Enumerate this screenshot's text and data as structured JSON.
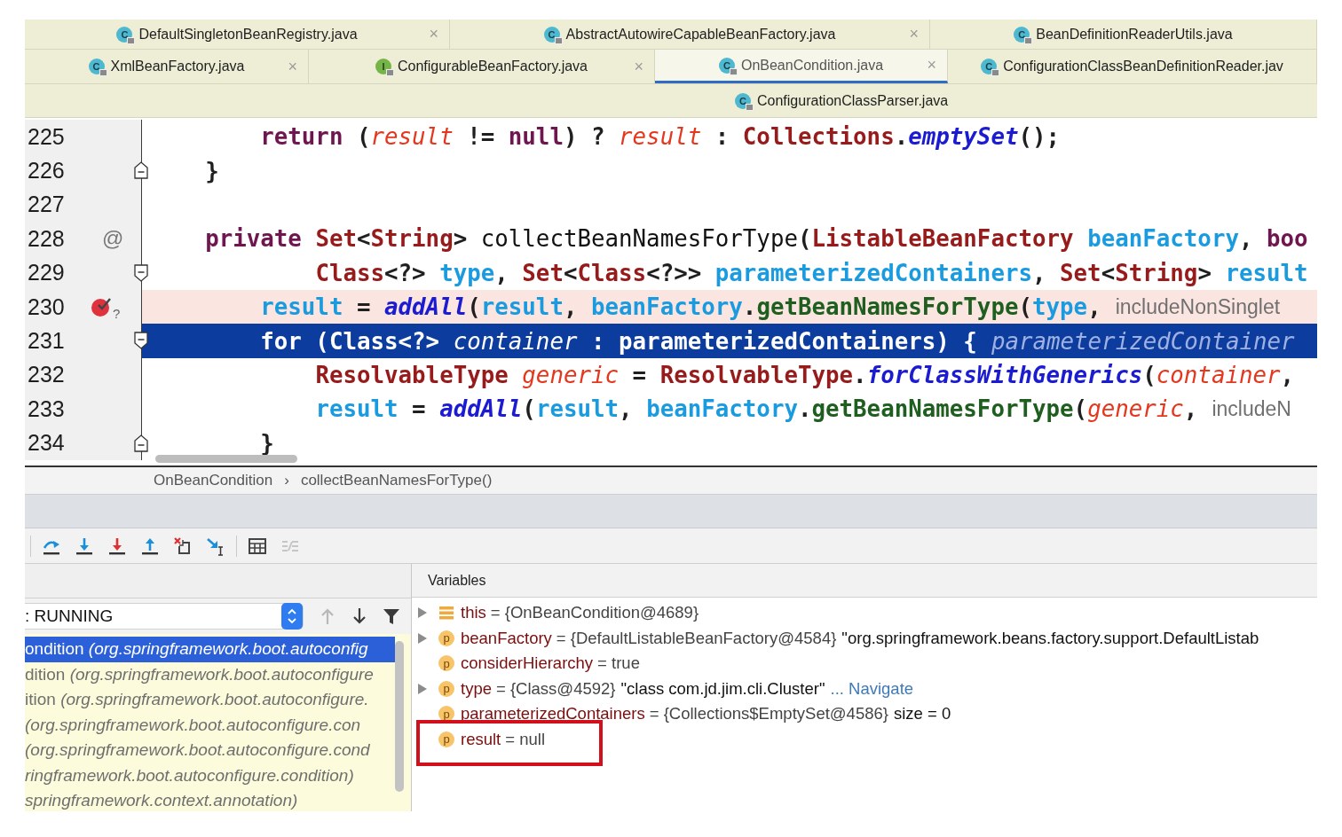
{
  "tab_rows": [
    [
      {
        "label": "DefaultSingletonBeanRegistry.java",
        "kind": "class",
        "icon_letter": "C",
        "close": "×",
        "selected": false
      },
      {
        "label": "AbstractAutowireCapableBeanFactory.java",
        "kind": "class",
        "icon_letter": "C",
        "close": "×",
        "selected": false
      },
      {
        "label": "BeanDefinitionReaderUtils.java",
        "kind": "class",
        "icon_letter": "C",
        "selected": false
      }
    ],
    [
      {
        "label": "XmlBeanFactory.java",
        "kind": "class",
        "icon_letter": "C",
        "close": "×",
        "selected": false
      },
      {
        "label": "ConfigurableBeanFactory.java",
        "kind": "interface",
        "icon_letter": "I",
        "close": "×",
        "selected": false
      },
      {
        "label": "OnBeanCondition.java",
        "kind": "class",
        "icon_letter": "C",
        "close": "×",
        "selected": true
      },
      {
        "label": "ConfigurationClassBeanDefinitionReader.jav",
        "kind": "class",
        "icon_letter": "C",
        "selected": false
      }
    ],
    [
      {
        "label": "ConfigurationClassParser.java",
        "kind": "class",
        "icon_letter": "C",
        "selected": false
      }
    ]
  ],
  "editor": {
    "lines": [
      {
        "number": "225",
        "kind": "plain",
        "breakpoint": false,
        "current": false,
        "tokens": [
          {
            "kind": "keyword",
            "text": "        return"
          },
          {
            "kind": "plain",
            "text": " ("
          },
          {
            "kind": "local",
            "text": "result"
          },
          {
            "kind": "plain",
            "text": " != "
          },
          {
            "kind": "keyword",
            "text": "null"
          },
          {
            "kind": "plain",
            "text": ") ? "
          },
          {
            "kind": "local",
            "text": "result"
          },
          {
            "kind": "plain",
            "text": " : "
          },
          {
            "kind": "type",
            "text": "Collections"
          },
          {
            "kind": "plain",
            "text": "."
          },
          {
            "kind": "static",
            "text": "emptySet"
          },
          {
            "kind": "plain",
            "text": "();"
          }
        ]
      },
      {
        "number": "226",
        "kind": "fold-end",
        "breakpoint": false,
        "current": false,
        "tokens": [
          {
            "kind": "plain",
            "text": "    }"
          }
        ]
      },
      {
        "number": "227",
        "kind": "plain",
        "breakpoint": false,
        "current": false
      },
      {
        "number": "228",
        "kind": "plain",
        "gutter_text": "@",
        "breakpoint": false,
        "current": false,
        "tokens": [
          {
            "kind": "keyword",
            "text": "    private "
          },
          {
            "kind": "type",
            "text": "Set"
          },
          {
            "kind": "plain",
            "text": "<"
          },
          {
            "kind": "type",
            "text": "String"
          },
          {
            "kind": "plain",
            "text": "> "
          },
          {
            "kind": "decl",
            "text": "collectBeanNamesForType"
          },
          {
            "kind": "plain",
            "text": "("
          },
          {
            "kind": "type",
            "text": "ListableBeanFactory "
          },
          {
            "kind": "param",
            "text": "beanFactory"
          },
          {
            "kind": "plain",
            "text": ", "
          },
          {
            "kind": "keyword",
            "text": "boo"
          }
        ]
      },
      {
        "number": "229",
        "kind": "fold-start",
        "breakpoint": false,
        "current": false,
        "tokens": [
          {
            "kind": "type",
            "text": "            Class"
          },
          {
            "kind": "plain",
            "text": "<?> "
          },
          {
            "kind": "param",
            "text": "type"
          },
          {
            "kind": "plain",
            "text": ", "
          },
          {
            "kind": "type",
            "text": "Set"
          },
          {
            "kind": "plain",
            "text": "<"
          },
          {
            "kind": "type",
            "text": "Class"
          },
          {
            "kind": "plain",
            "text": "<?>> "
          },
          {
            "kind": "param",
            "text": "parameterizedContainers"
          },
          {
            "kind": "plain",
            "text": ", "
          },
          {
            "kind": "type",
            "text": "Set"
          },
          {
            "kind": "plain",
            "text": "<"
          },
          {
            "kind": "type",
            "text": "String"
          },
          {
            "kind": "plain",
            "text": "> "
          },
          {
            "kind": "param",
            "text": "result"
          }
        ]
      },
      {
        "number": "230",
        "kind": "plain",
        "gutter_text": "?",
        "breakpoint": true,
        "current": false,
        "tokens": [
          {
            "kind": "param",
            "text": "        result"
          },
          {
            "kind": "plain",
            "text": " = "
          },
          {
            "kind": "static",
            "text": "addAll"
          },
          {
            "kind": "plain",
            "text": "("
          },
          {
            "kind": "param",
            "text": "result"
          },
          {
            "kind": "plain",
            "text": ", "
          },
          {
            "kind": "param",
            "text": "beanFactory"
          },
          {
            "kind": "plain",
            "text": "."
          },
          {
            "kind": "method",
            "text": "getBeanNamesForType"
          },
          {
            "kind": "plain",
            "text": "("
          },
          {
            "kind": "param",
            "text": "type"
          },
          {
            "kind": "plain",
            "text": ","
          }
        ],
        "hint": "includeNonSinglet"
      },
      {
        "number": "231",
        "kind": "fold-start",
        "breakpoint": false,
        "current": true,
        "tokens": [
          {
            "kind": "keyword",
            "text": "        for"
          },
          {
            "kind": "plain",
            "text": " ("
          },
          {
            "kind": "type",
            "text": "Class"
          },
          {
            "kind": "plain",
            "text": "<?> "
          },
          {
            "kind": "local",
            "text": "container"
          },
          {
            "kind": "plain",
            "text": " : "
          },
          {
            "kind": "param",
            "text": "parameterizedContainers"
          },
          {
            "kind": "plain",
            "text": ") {"
          }
        ],
        "hint": "parameterizedContainer"
      },
      {
        "number": "232",
        "kind": "plain",
        "breakpoint": false,
        "current": false,
        "tokens": [
          {
            "kind": "type",
            "text": "            ResolvableType "
          },
          {
            "kind": "local",
            "text": "generic"
          },
          {
            "kind": "plain",
            "text": " = "
          },
          {
            "kind": "type",
            "text": "ResolvableType"
          },
          {
            "kind": "plain",
            "text": "."
          },
          {
            "kind": "static",
            "text": "forClassWithGenerics"
          },
          {
            "kind": "plain",
            "text": "("
          },
          {
            "kind": "local",
            "text": "container"
          },
          {
            "kind": "plain",
            "text": ","
          }
        ]
      },
      {
        "number": "233",
        "kind": "plain",
        "breakpoint": false,
        "current": false,
        "tokens": [
          {
            "kind": "param",
            "text": "            result"
          },
          {
            "kind": "plain",
            "text": " = "
          },
          {
            "kind": "static",
            "text": "addAll"
          },
          {
            "kind": "plain",
            "text": "("
          },
          {
            "kind": "param",
            "text": "result"
          },
          {
            "kind": "plain",
            "text": ", "
          },
          {
            "kind": "param",
            "text": "beanFactory"
          },
          {
            "kind": "plain",
            "text": "."
          },
          {
            "kind": "method",
            "text": "getBeanNamesForType"
          },
          {
            "kind": "plain",
            "text": "("
          },
          {
            "kind": "local",
            "text": "generic"
          },
          {
            "kind": "plain",
            "text": ","
          }
        ],
        "hint": "includeN"
      },
      {
        "number": "234",
        "kind": "fold-end",
        "breakpoint": false,
        "current": false,
        "tokens": [
          {
            "kind": "plain",
            "text": "        }"
          }
        ]
      }
    ]
  },
  "breadcrumbs": {
    "items": [
      "OnBeanCondition",
      "collectBeanNamesForType()"
    ],
    "separator": "›"
  },
  "toolbar": {
    "groups": [
      [
        {
          "kind": "step-over",
          "disabled": false
        },
        {
          "kind": "step-into",
          "disabled": false
        },
        {
          "kind": "force-step-into",
          "disabled": false
        },
        {
          "kind": "step-out",
          "disabled": false
        },
        {
          "kind": "drop-frame",
          "disabled": false
        },
        {
          "kind": "run-to-cursor",
          "disabled": false
        }
      ],
      [
        {
          "kind": "evaluate",
          "disabled": false
        },
        {
          "kind": "trace",
          "disabled": true
        }
      ]
    ]
  },
  "frames_panel": {
    "thread": {
      "value": ": RUNNING"
    },
    "controls": [
      {
        "kind": "up",
        "disabled": true
      },
      {
        "kind": "down",
        "disabled": false
      },
      {
        "kind": "filter",
        "disabled": false
      }
    ],
    "frames": [
      {
        "text": "ondition *(org.springframework.boot.autoconfig*",
        "selected": true
      },
      {
        "text": "dition *(org.springframework.boot.autoconfigure*",
        "selected": false
      },
      {
        "text": "ition *(org.springframework.boot.autoconfigure.*",
        "selected": false
      },
      {
        "text": " *(org.springframework.boot.autoconfigure.con*",
        "selected": false
      },
      {
        "text": "*(org.springframework.boot.autoconfigure.cond*",
        "selected": false
      },
      {
        "text": "*ringframework.boot.autoconfigure.condition)*",
        "selected": false
      },
      {
        "text": "*springframework.context.annotation)*",
        "selected": false
      }
    ]
  },
  "variables": {
    "title": "Variables",
    "items": [
      {
        "kind": "fields",
        "expandable": true,
        "name": "this",
        "value": "= {OnBeanCondition@4689}",
        "annotated": false
      },
      {
        "kind": "param",
        "badge": "p",
        "expandable": true,
        "name": "beanFactory",
        "value": "= {DefaultListableBeanFactory@4584}",
        "detail": "\"org.springframework.beans.factory.support.DefaultListab",
        "annotated": false
      },
      {
        "kind": "param",
        "badge": "p",
        "expandable": false,
        "name": "considerHierarchy",
        "value": "= true",
        "annotated": false
      },
      {
        "kind": "param",
        "badge": "p",
        "expandable": true,
        "name": "type",
        "value": "= {Class@4592}",
        "detail": "\"class com.jd.jim.cli.Cluster\"",
        "link": "... Navigate",
        "annotated": false
      },
      {
        "kind": "param",
        "badge": "p",
        "expandable": false,
        "name": "parameterizedContainers",
        "value": "= {Collections$EmptySet@4586}",
        "detail": "size = 0",
        "annotated": false
      },
      {
        "kind": "param",
        "badge": "p",
        "expandable": false,
        "name": "result",
        "value": "= null",
        "annotated": true
      }
    ]
  }
}
